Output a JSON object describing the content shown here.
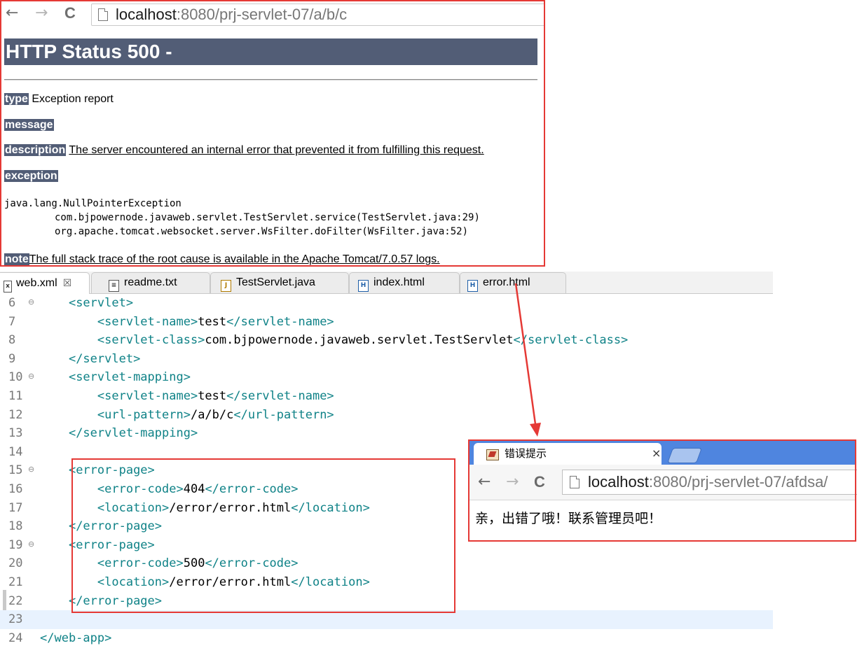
{
  "top_browser": {
    "nav": {
      "back": "←",
      "forward": "→",
      "reload": "C"
    },
    "url_host": "localhost",
    "url_rest": ":8080/prj-servlet-07/a/b/c",
    "status_title": "HTTP Status 500 -",
    "rows": {
      "type_label": "type",
      "type_value": "Exception report",
      "message_label": "message",
      "description_label": "description",
      "description_value": "The server encountered an internal error that prevented it from fulfilling this request.",
      "exception_label": "exception",
      "note_label": "note",
      "note_value": "The full stack trace of the root cause is available in the Apache Tomcat/7.0.57 logs."
    },
    "stack_trace": [
      "java.lang.NullPointerException",
      "\tcom.bjpowernode.javaweb.servlet.TestServlet.service(TestServlet.java:29)",
      "\torg.apache.tomcat.websocket.server.WsFilter.doFilter(WsFilter.java:52)"
    ]
  },
  "editor": {
    "tabs": [
      {
        "label": "web.xml",
        "icon": "x",
        "close": "☒"
      },
      {
        "label": "readme.txt",
        "icon": "≡"
      },
      {
        "label": "TestServlet.java",
        "icon": "J"
      },
      {
        "label": "index.html",
        "icon": "H"
      },
      {
        "label": "error.html",
        "icon": "H"
      }
    ],
    "lines": [
      {
        "num": "6",
        "fold": "⊖",
        "indent": "    ",
        "open": "<servlet>",
        "text": "",
        "close": ""
      },
      {
        "num": "7",
        "fold": "",
        "indent": "        ",
        "open": "<servlet-name>",
        "text": "test",
        "close": "</servlet-name>"
      },
      {
        "num": "8",
        "fold": "",
        "indent": "        ",
        "open": "<servlet-class>",
        "text": "com.bjpowernode.javaweb.servlet.TestServlet",
        "close": "</servlet-class>"
      },
      {
        "num": "9",
        "fold": "",
        "indent": "    ",
        "open": "</servlet>",
        "text": "",
        "close": ""
      },
      {
        "num": "10",
        "fold": "⊖",
        "indent": "    ",
        "open": "<servlet-mapping>",
        "text": "",
        "close": ""
      },
      {
        "num": "11",
        "fold": "",
        "indent": "        ",
        "open": "<servlet-name>",
        "text": "test",
        "close": "</servlet-name>"
      },
      {
        "num": "12",
        "fold": "",
        "indent": "        ",
        "open": "<url-pattern>",
        "text": "/a/b/c",
        "close": "</url-pattern>"
      },
      {
        "num": "13",
        "fold": "",
        "indent": "    ",
        "open": "</servlet-mapping>",
        "text": "",
        "close": ""
      },
      {
        "num": "14",
        "fold": "",
        "indent": "",
        "open": "",
        "text": "",
        "close": ""
      },
      {
        "num": "15",
        "fold": "⊖",
        "indent": "    ",
        "open": "<error-page>",
        "text": "",
        "close": ""
      },
      {
        "num": "16",
        "fold": "",
        "indent": "        ",
        "open": "<error-code>",
        "text": "404",
        "close": "</error-code>"
      },
      {
        "num": "17",
        "fold": "",
        "indent": "        ",
        "open": "<location>",
        "text": "/error/error.html",
        "close": "</location>"
      },
      {
        "num": "18",
        "fold": "",
        "indent": "    ",
        "open": "</error-page>",
        "text": "",
        "close": ""
      },
      {
        "num": "19",
        "fold": "⊖",
        "indent": "    ",
        "open": "<error-page>",
        "text": "",
        "close": ""
      },
      {
        "num": "20",
        "fold": "",
        "indent": "        ",
        "open": "<error-code>",
        "text": "500",
        "close": "</error-code>"
      },
      {
        "num": "21",
        "fold": "",
        "indent": "        ",
        "open": "<location>",
        "text": "/error/error.html",
        "close": "</location>"
      },
      {
        "num": "22",
        "fold": "",
        "indent": "    ",
        "open": "</error-page>",
        "text": "",
        "close": ""
      },
      {
        "num": "23",
        "fold": "",
        "indent": "",
        "open": "",
        "text": "",
        "close": "",
        "current": true
      },
      {
        "num": "24",
        "fold": "",
        "indent": "",
        "open": "</web-app>",
        "text": "",
        "close": ""
      }
    ]
  },
  "error_browser": {
    "tab_title": "错误提示",
    "tab_close": "×",
    "nav": {
      "back": "←",
      "forward": "→",
      "reload": "C"
    },
    "url_host": "localhost",
    "url_rest": ":8080/prj-servlet-07/afdsa/",
    "content": "亲，出错了哦！联系管理员吧！"
  },
  "colors": {
    "highlight_border": "#e53935",
    "tomcat_label_bg": "#525d76",
    "xml_tag": "#0f8287",
    "chrome_tabstrip": "#4f85df"
  }
}
